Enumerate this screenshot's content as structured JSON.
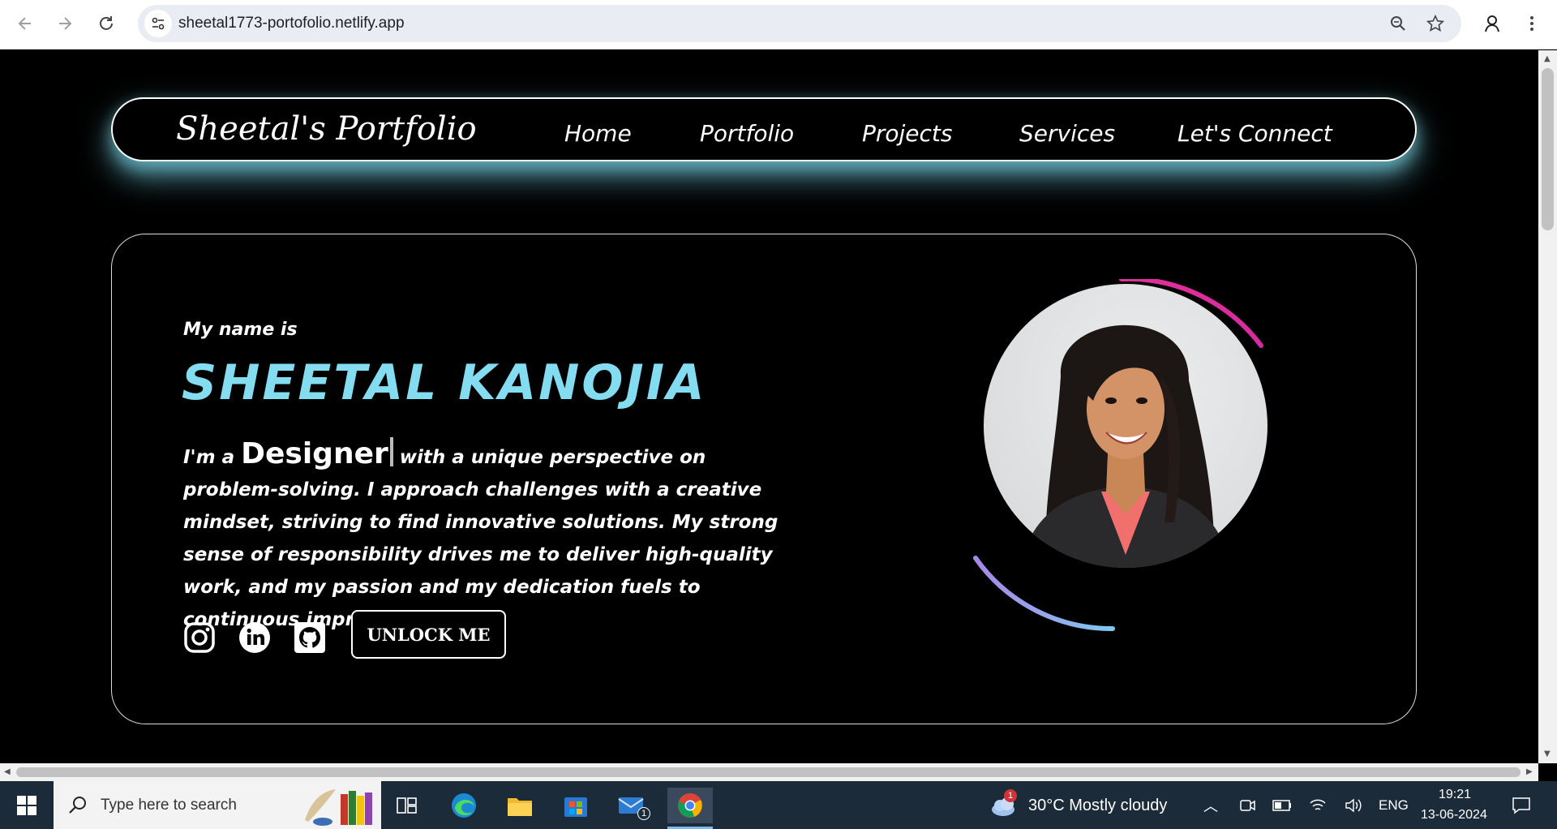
{
  "browser": {
    "url": "sheetal1773-portofolio.netlify.app"
  },
  "nav": {
    "brand": "Sheetal's Portfolio",
    "links": [
      "Home",
      "Portfolio",
      "Projects",
      "Services",
      "Let's Connect"
    ]
  },
  "hero": {
    "greeting": "My name is",
    "name": "SHEETAL KANOJIA",
    "bio_prefix": "I'm a",
    "role": "Designer",
    "bio_rest": "with a unique perspective on problem-solving. I approach challenges with a creative mindset, striving to find innovative solutions. My strong sense of responsibility drives me to deliver high-quality work, and my passion and my dedication fuels to continuous improvement.",
    "unlock_button": "UNLOCK ME",
    "social_icons": [
      "instagram-icon",
      "linkedin-icon",
      "github-icon"
    ]
  },
  "colors": {
    "name_accent": "#84dcf0",
    "nav_glow": "#6ac4d6",
    "arc_top": "#e0309a",
    "arc_bottom_start": "#a987e6",
    "arc_bottom_end": "#7ec9ef"
  },
  "taskbar": {
    "search_placeholder": "Type here to search",
    "mail_badge": "1",
    "weather_badge": "1",
    "weather": "30°C  Mostly cloudy",
    "language": "ENG",
    "time": "19:21",
    "date": "13-06-2024"
  }
}
